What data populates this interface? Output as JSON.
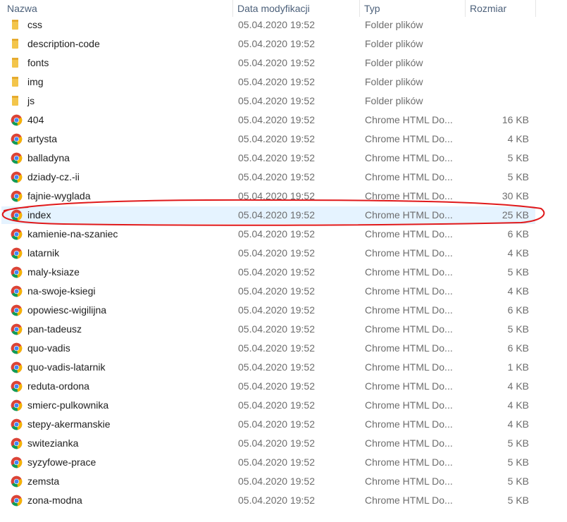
{
  "columns": {
    "name": "Nazwa",
    "date": "Data modyfikacji",
    "type": "Typ",
    "size": "Rozmiar"
  },
  "colors": {
    "folder": "#f3c54b",
    "selection": "#e5f3ff",
    "annotation": "#e0191b",
    "header_text": "#4c607a"
  },
  "rows": [
    {
      "name": "css",
      "date": "05.04.2020 19:52",
      "type": "Folder plików",
      "size": "",
      "icon": "folder-icon"
    },
    {
      "name": "description-code",
      "date": "05.04.2020 19:52",
      "type": "Folder plików",
      "size": "",
      "icon": "folder-icon"
    },
    {
      "name": "fonts",
      "date": "05.04.2020 19:52",
      "type": "Folder plików",
      "size": "",
      "icon": "folder-icon"
    },
    {
      "name": "img",
      "date": "05.04.2020 19:52",
      "type": "Folder plików",
      "size": "",
      "icon": "folder-icon"
    },
    {
      "name": "js",
      "date": "05.04.2020 19:52",
      "type": "Folder plików",
      "size": "",
      "icon": "folder-icon"
    },
    {
      "name": "404",
      "date": "05.04.2020 19:52",
      "type": "Chrome HTML Do...",
      "size": "16 KB",
      "icon": "chrome-icon"
    },
    {
      "name": "artysta",
      "date": "05.04.2020 19:52",
      "type": "Chrome HTML Do...",
      "size": "4 KB",
      "icon": "chrome-icon"
    },
    {
      "name": "balladyna",
      "date": "05.04.2020 19:52",
      "type": "Chrome HTML Do...",
      "size": "5 KB",
      "icon": "chrome-icon"
    },
    {
      "name": "dziady-cz.-ii",
      "date": "05.04.2020 19:52",
      "type": "Chrome HTML Do...",
      "size": "5 KB",
      "icon": "chrome-icon"
    },
    {
      "name": "fajnie-wyglada",
      "date": "05.04.2020 19:52",
      "type": "Chrome HTML Do...",
      "size": "30 KB",
      "icon": "chrome-icon"
    },
    {
      "name": "index",
      "date": "05.04.2020 19:52",
      "type": "Chrome HTML Do...",
      "size": "25 KB",
      "icon": "chrome-icon",
      "selected": true
    },
    {
      "name": "kamienie-na-szaniec",
      "date": "05.04.2020 19:52",
      "type": "Chrome HTML Do...",
      "size": "6 KB",
      "icon": "chrome-icon"
    },
    {
      "name": "latarnik",
      "date": "05.04.2020 19:52",
      "type": "Chrome HTML Do...",
      "size": "4 KB",
      "icon": "chrome-icon"
    },
    {
      "name": "maly-ksiaze",
      "date": "05.04.2020 19:52",
      "type": "Chrome HTML Do...",
      "size": "5 KB",
      "icon": "chrome-icon"
    },
    {
      "name": "na-swoje-ksiegi",
      "date": "05.04.2020 19:52",
      "type": "Chrome HTML Do...",
      "size": "4 KB",
      "icon": "chrome-icon"
    },
    {
      "name": "opowiesc-wigilijna",
      "date": "05.04.2020 19:52",
      "type": "Chrome HTML Do...",
      "size": "6 KB",
      "icon": "chrome-icon"
    },
    {
      "name": "pan-tadeusz",
      "date": "05.04.2020 19:52",
      "type": "Chrome HTML Do...",
      "size": "5 KB",
      "icon": "chrome-icon"
    },
    {
      "name": "quo-vadis",
      "date": "05.04.2020 19:52",
      "type": "Chrome HTML Do...",
      "size": "6 KB",
      "icon": "chrome-icon"
    },
    {
      "name": "quo-vadis-latarnik",
      "date": "05.04.2020 19:52",
      "type": "Chrome HTML Do...",
      "size": "1 KB",
      "icon": "chrome-icon"
    },
    {
      "name": "reduta-ordona",
      "date": "05.04.2020 19:52",
      "type": "Chrome HTML Do...",
      "size": "4 KB",
      "icon": "chrome-icon"
    },
    {
      "name": "smierc-pulkownika",
      "date": "05.04.2020 19:52",
      "type": "Chrome HTML Do...",
      "size": "4 KB",
      "icon": "chrome-icon"
    },
    {
      "name": "stepy-akermanskie",
      "date": "05.04.2020 19:52",
      "type": "Chrome HTML Do...",
      "size": "4 KB",
      "icon": "chrome-icon"
    },
    {
      "name": "switezianka",
      "date": "05.04.2020 19:52",
      "type": "Chrome HTML Do...",
      "size": "5 KB",
      "icon": "chrome-icon"
    },
    {
      "name": "syzyfowe-prace",
      "date": "05.04.2020 19:52",
      "type": "Chrome HTML Do...",
      "size": "5 KB",
      "icon": "chrome-icon"
    },
    {
      "name": "zemsta",
      "date": "05.04.2020 19:52",
      "type": "Chrome HTML Do...",
      "size": "5 KB",
      "icon": "chrome-icon"
    },
    {
      "name": "zona-modna",
      "date": "05.04.2020 19:52",
      "type": "Chrome HTML Do...",
      "size": "5 KB",
      "icon": "chrome-icon"
    }
  ]
}
